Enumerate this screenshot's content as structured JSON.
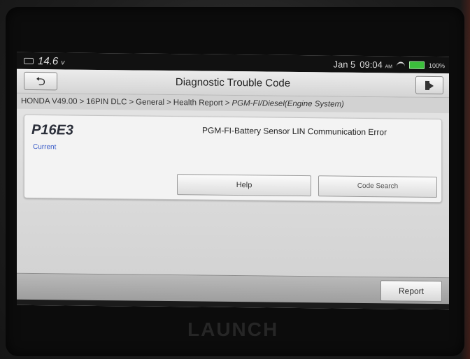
{
  "status_bar": {
    "voltage": "14.6",
    "voltage_unit": "v",
    "date": "Jan 5",
    "time": "09:04",
    "ampm": "AM",
    "battery": "100%"
  },
  "title_bar": {
    "title": "Diagnostic Trouble Code"
  },
  "breadcrumb": {
    "items": [
      "HONDA V49.00",
      "16PIN DLC",
      "General",
      "Health Report",
      "PGM-FI/Diesel(Engine System)"
    ],
    "separator": ">"
  },
  "dtc": {
    "code": "P16E3",
    "status": "Current",
    "description": "PGM-FI-Battery Sensor LIN Communication Error"
  },
  "buttons": {
    "help": "Help",
    "code_search": "Code Search",
    "report": "Report"
  },
  "device": {
    "brand": "LAUNCH"
  },
  "colors": {
    "status_text": "#3a5cc8",
    "battery": "#3cbf3c"
  }
}
